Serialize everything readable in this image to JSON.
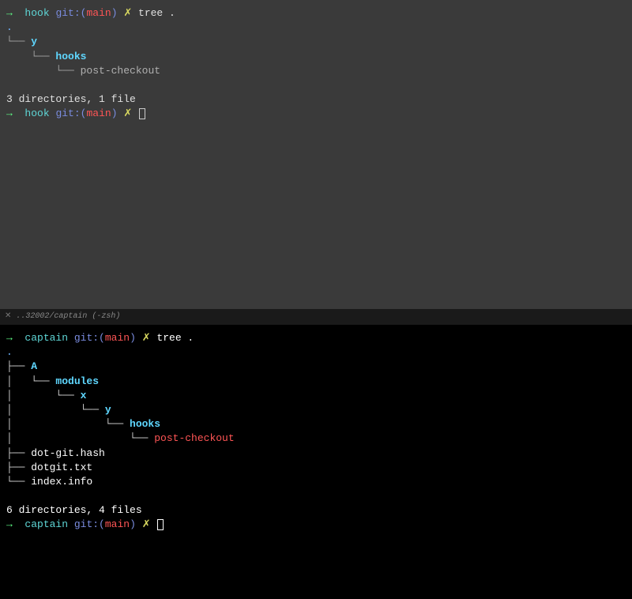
{
  "top": {
    "prompt1": {
      "arrow": "→",
      "dir": "hook",
      "gitLabel": "git:(",
      "branch": "main",
      "gitClose": ")",
      "dirty": "✗",
      "command": "tree ."
    },
    "tree": {
      "dot": ".",
      "line1_prefix": "└── ",
      "line1_name": "y",
      "line2_prefix": "    └── ",
      "line2_name": "hooks",
      "line3_prefix": "        └── ",
      "line3_name": "post-checkout"
    },
    "summary": "3 directories, 1 file",
    "prompt2": {
      "arrow": "→",
      "dir": "hook",
      "gitLabel": "git:(",
      "branch": "main",
      "gitClose": ")",
      "dirty": "✗"
    }
  },
  "tab": {
    "close": "✕",
    "label": "..32002/captain (-zsh)"
  },
  "bottom": {
    "prompt1": {
      "arrow": "→",
      "dir": "captain",
      "gitLabel": "git:(",
      "branch": "main",
      "gitClose": ")",
      "dirty": "✗",
      "command": "tree ."
    },
    "tree": {
      "dot": ".",
      "line1_prefix": "├── ",
      "line1_name": "A",
      "line2_prefix": "│   └── ",
      "line2_name": "modules",
      "line3_prefix": "│       └── ",
      "line3_name": "x",
      "line4_prefix": "│           └── ",
      "line4_name": "y",
      "line5_prefix": "│               └── ",
      "line5_name": "hooks",
      "line6_prefix": "│                   └── ",
      "line6_name": "post-checkout",
      "line7_prefix": "├── ",
      "line7_name": "dot-git.hash",
      "line8_prefix": "├── ",
      "line8_name": "dotgit.txt",
      "line9_prefix": "└── ",
      "line9_name": "index.info"
    },
    "summary": "6 directories, 4 files",
    "prompt2": {
      "arrow": "→",
      "dir": "captain",
      "gitLabel": "git:(",
      "branch": "main",
      "gitClose": ")",
      "dirty": "✗"
    }
  }
}
